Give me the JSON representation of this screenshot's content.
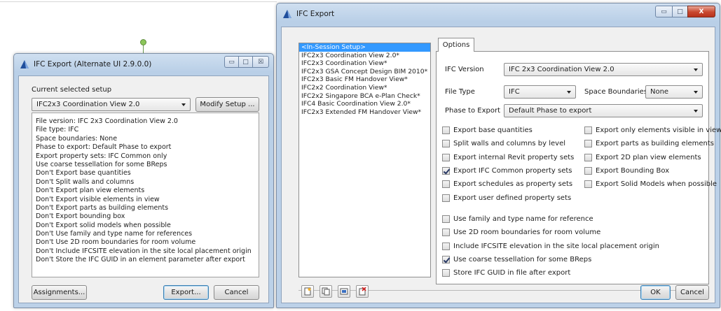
{
  "colors": {
    "selection": "#3399ff",
    "window_frame": "#b9cfe7",
    "close_button": "#c9482f",
    "dialog_face": "#f0f0f0"
  },
  "left_window": {
    "title": "IFC Export (Alternate UI 2.9.0.0)",
    "current_setup_label": "Current selected setup",
    "setup_combo_value": "IFC2x3 Coordination View 2.0",
    "modify_setup_button": "Modify Setup ...",
    "info_lines": [
      "File version: IFC 2x3 Coordination View 2.0",
      "File type: IFC",
      "Space boundaries: None",
      "Phase to export: Default Phase to export",
      "Export property sets: IFC Common only",
      "Use coarse tessellation for some BReps",
      "Don't Export base quantities",
      "Don't Split walls and columns",
      "Don't Export plan view elements",
      "Don't Export visible elements in view",
      "Don't Export parts as building elements",
      "Don't Export bounding box",
      "Don't Export solid models when possible",
      "Don't Use family and type name for references",
      "Don't Use 2D room boundaries for room volume",
      "Don't Include IFCSITE elevation in the site local placement origin",
      "Don't Store the IFC GUID in an element parameter after export"
    ],
    "assignments_button": "Assignments...",
    "export_button": "Export...",
    "cancel_button": "Cancel",
    "caption": {
      "minimize": "▭",
      "maximize": "□",
      "close": "☒"
    }
  },
  "right_window": {
    "title": "IFC Export",
    "caption": {
      "minimize": "▭",
      "maximize": "□",
      "close": "X"
    },
    "setups": [
      "<In-Session Setup>",
      "IFC2x3 Coordination View 2.0*",
      "IFC2x3 Coordination View*",
      "IFC2x3 GSA Concept Design BIM 2010*",
      "IFC2x3 Basic FM Handover View*",
      "IFC2x2 Coordination View*",
      "IFC2x2 Singapore BCA e-Plan Check*",
      "IFC4 Basic Coordination View 2.0*",
      "IFC2x3 Extended FM Handover View*"
    ],
    "selected_setup_index": 0,
    "options_tab": "Options",
    "ifc_version_label": "IFC Version",
    "ifc_version_value": "IFC 2x3 Coordination View 2.0",
    "file_type_label": "File Type",
    "file_type_value": "IFC",
    "space_boundaries_label": "Space Boundaries",
    "space_boundaries_value": "None",
    "phase_label": "Phase to Export",
    "phase_value": "Default Phase to export",
    "left_checks": [
      {
        "label": "Export base quantities",
        "checked": false
      },
      {
        "label": "Split walls and columns by level",
        "checked": false
      },
      {
        "label": "Export internal Revit property sets",
        "checked": false
      },
      {
        "label": "Export IFC Common property sets",
        "checked": true
      },
      {
        "label": "Export schedules as property sets",
        "checked": false
      },
      {
        "label": "Export user defined property sets",
        "checked": false
      }
    ],
    "right_checks": [
      {
        "label": "Export only elements visible in view",
        "checked": false
      },
      {
        "label": "Export parts as building elements",
        "checked": false
      },
      {
        "label": "Export 2D plan view elements",
        "checked": false
      },
      {
        "label": "Export Bounding Box",
        "checked": false
      },
      {
        "label": "Export Solid Models when possible",
        "checked": false
      }
    ],
    "lower_checks": [
      {
        "label": "Use family and type name for reference",
        "checked": false
      },
      {
        "label": "Use 2D room boundaries for room volume",
        "checked": false
      },
      {
        "label": "Include IFCSITE elevation in the site local placement origin",
        "checked": false
      },
      {
        "label": "Use coarse tessellation for some BReps",
        "checked": true
      },
      {
        "label": "Store IFC GUID in file after export",
        "checked": false
      }
    ],
    "ok_button": "OK",
    "cancel_button": "Cancel",
    "toolbar_icons": [
      "new-setup-icon",
      "duplicate-setup-icon",
      "rename-setup-icon",
      "delete-setup-icon"
    ]
  }
}
